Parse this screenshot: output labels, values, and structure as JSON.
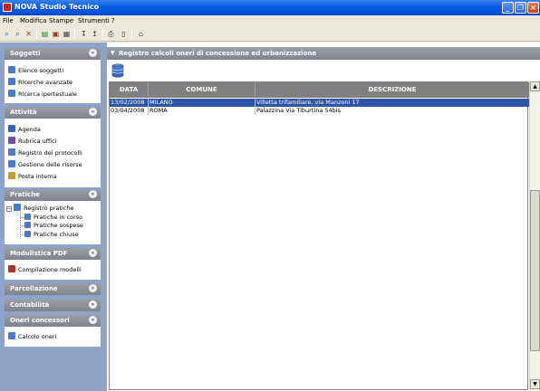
{
  "window": {
    "title": "NOVA Studio Tecnico",
    "min_glyph": "_",
    "max_glyph": "❐",
    "close_glyph": "×"
  },
  "menu": [
    "File",
    "Modifica",
    "Stampe",
    "Strumenti",
    "?"
  ],
  "toolbar": {
    "icons": [
      "search-text-icon",
      "search-doc-icon",
      "filter-icon",
      "export-icon",
      "print-icon",
      "copy-icon",
      "arrow-down-icon",
      "arrow-up-icon",
      "printer-icon",
      "document-icon",
      "building-icon"
    ]
  },
  "sidebar": {
    "panels": [
      {
        "title": "Soggetti",
        "toggle": "«",
        "items": [
          "Elenco soggetti",
          "Ricerche avanzate",
          "Ricerca ipertestuale"
        ]
      },
      {
        "title": "Attività",
        "toggle": "«",
        "items": [
          "Agenda",
          "Rubrica uffici",
          "Registro dei protocolli",
          "Gestione delle risorse",
          "Posta interna"
        ]
      },
      {
        "title": "Pratiche",
        "toggle": "«",
        "tree_root": "Registro pratiche",
        "tree_children": [
          "Pratiche in corso",
          "Pratiche sospese",
          "Pratiche chiuse"
        ]
      },
      {
        "title": "Modulistica PDF",
        "toggle": "«",
        "items": [
          "Compilazione modelli"
        ]
      },
      {
        "title": "Parcellazione",
        "toggle": "»"
      },
      {
        "title": "Contabilità",
        "toggle": "»"
      },
      {
        "title": "Oneri concessori",
        "toggle": "«",
        "items": [
          "Calcolo oneri"
        ]
      }
    ]
  },
  "main": {
    "header_arrow": "▼",
    "header_title": "Registro calcoli oneri di concessione ed urbanizzazione",
    "columns": [
      "DATA",
      "COMUNE",
      "DESCRIZIONE"
    ],
    "rows": [
      {
        "data": "13/02/2008",
        "comune": "MILANO",
        "descrizione": "Villetta trifamiliare, via Manzoni 17",
        "selected": true
      },
      {
        "data": "03/04/2008",
        "comune": "ROMA",
        "descrizione": "Palazzina Via Tiburtina 54bis",
        "selected": false
      }
    ],
    "scroll_up": "▲",
    "scroll_down": "▼"
  },
  "colors": {
    "titlebar": "#0a5fe0",
    "sidebar_bg": "#8fa3c8",
    "panel_header": "#8a8e96",
    "grid_header": "#808080",
    "selection": "#2e55a8"
  }
}
